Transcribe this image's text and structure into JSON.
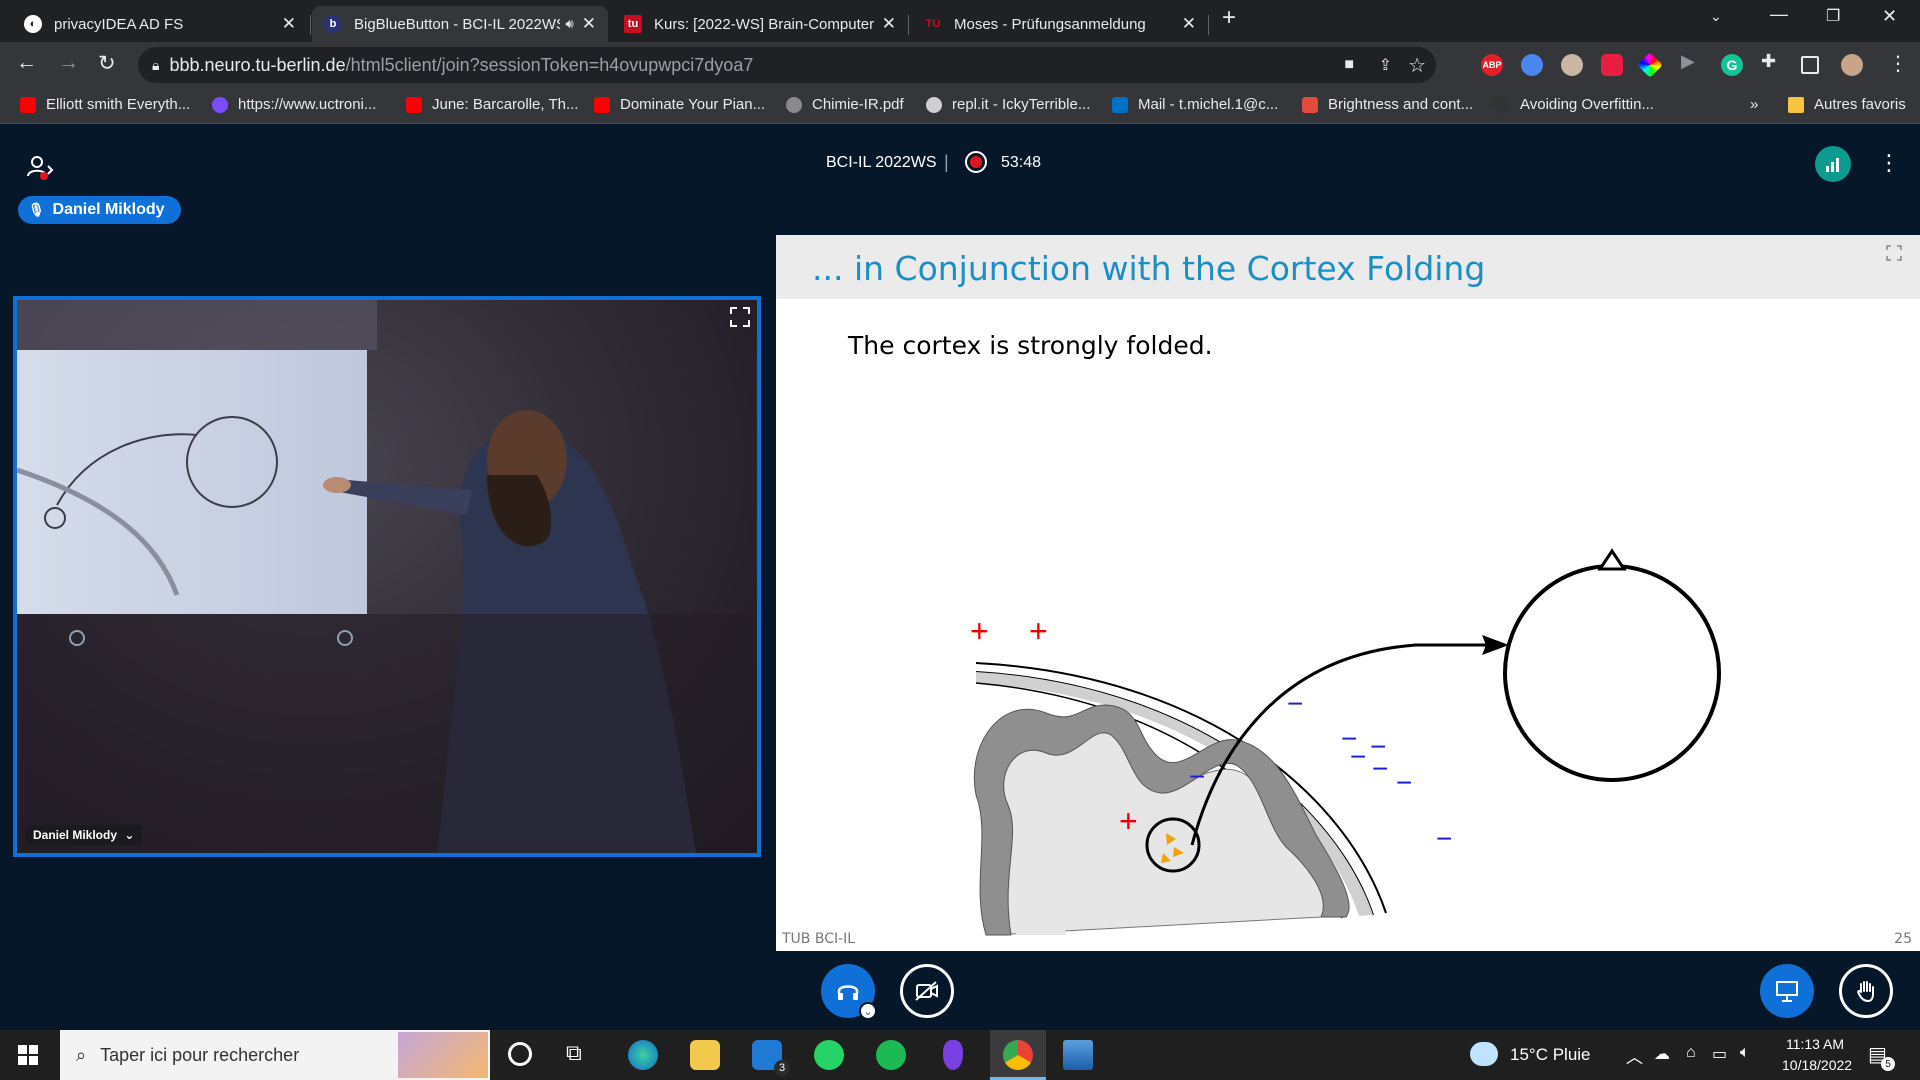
{
  "browser": {
    "tabs": [
      {
        "title": "privacyIDEA AD FS",
        "favicon_color": "#ffffff",
        "active": false
      },
      {
        "title": "BigBlueButton - BCI-IL 2022WS",
        "favicon_color": "#283274",
        "active": true
      },
      {
        "title": "Kurs: [2022-WS] Brain-Computer",
        "favicon_color": "#c50e1f",
        "active": false
      },
      {
        "title": "Moses - Prüfungsanmeldung",
        "favicon_color": "#c50e1f",
        "active": false
      }
    ],
    "url_host": "bbb.neuro.tu-berlin.de",
    "url_path": "/html5client/join?sessionToken=h4ovupwpci7dyoa7",
    "bookmarks": [
      {
        "label": "Elliott smith Everyth...",
        "color": "#ff0000"
      },
      {
        "label": "https://www.uctroni...",
        "color": "#7b4dff"
      },
      {
        "label": "June: Barcarolle, Th...",
        "color": "#ff0000"
      },
      {
        "label": "Dominate Your Pian...",
        "color": "#ff0000"
      },
      {
        "label": "Chimie-IR.pdf",
        "color": "#8a8a8a"
      },
      {
        "label": "repl.it - IckyTerrible...",
        "color": "#cfcfcf"
      },
      {
        "label": "Mail - t.michel.1@c...",
        "color": "#0072c6"
      },
      {
        "label": "Brightness and cont...",
        "color": "#e24a3b"
      },
      {
        "label": "Avoiding Overfittin...",
        "color": "#333333"
      }
    ],
    "bookmarks_overflow": "»",
    "other_bookmarks": "Autres favoris"
  },
  "meeting": {
    "talker": "Daniel Miklody",
    "title": "BCI-IL 2022WS",
    "separator": "|",
    "recording_time": "53:48",
    "webcam_name": "Daniel Miklody"
  },
  "slide": {
    "title": "... in Conjunction with the Cortex Folding",
    "text": "The cortex is strongly folded.",
    "footer_left": "TUB BCI-IL",
    "page_number": "25",
    "plus_sign": "+",
    "minus_sign": "−"
  },
  "taskbar": {
    "search_placeholder": "Taper ici pour rechercher",
    "mail_badge": "3",
    "weather": "15°C  Pluie",
    "time": "11:13 AM",
    "date": "10/18/2022",
    "notification_count": "5"
  },
  "colors": {
    "bbb_background": "#06172a",
    "bbb_blue": "#0f70d7",
    "slide_title": "#1c8ec6",
    "recording_red": "#e0141e"
  }
}
